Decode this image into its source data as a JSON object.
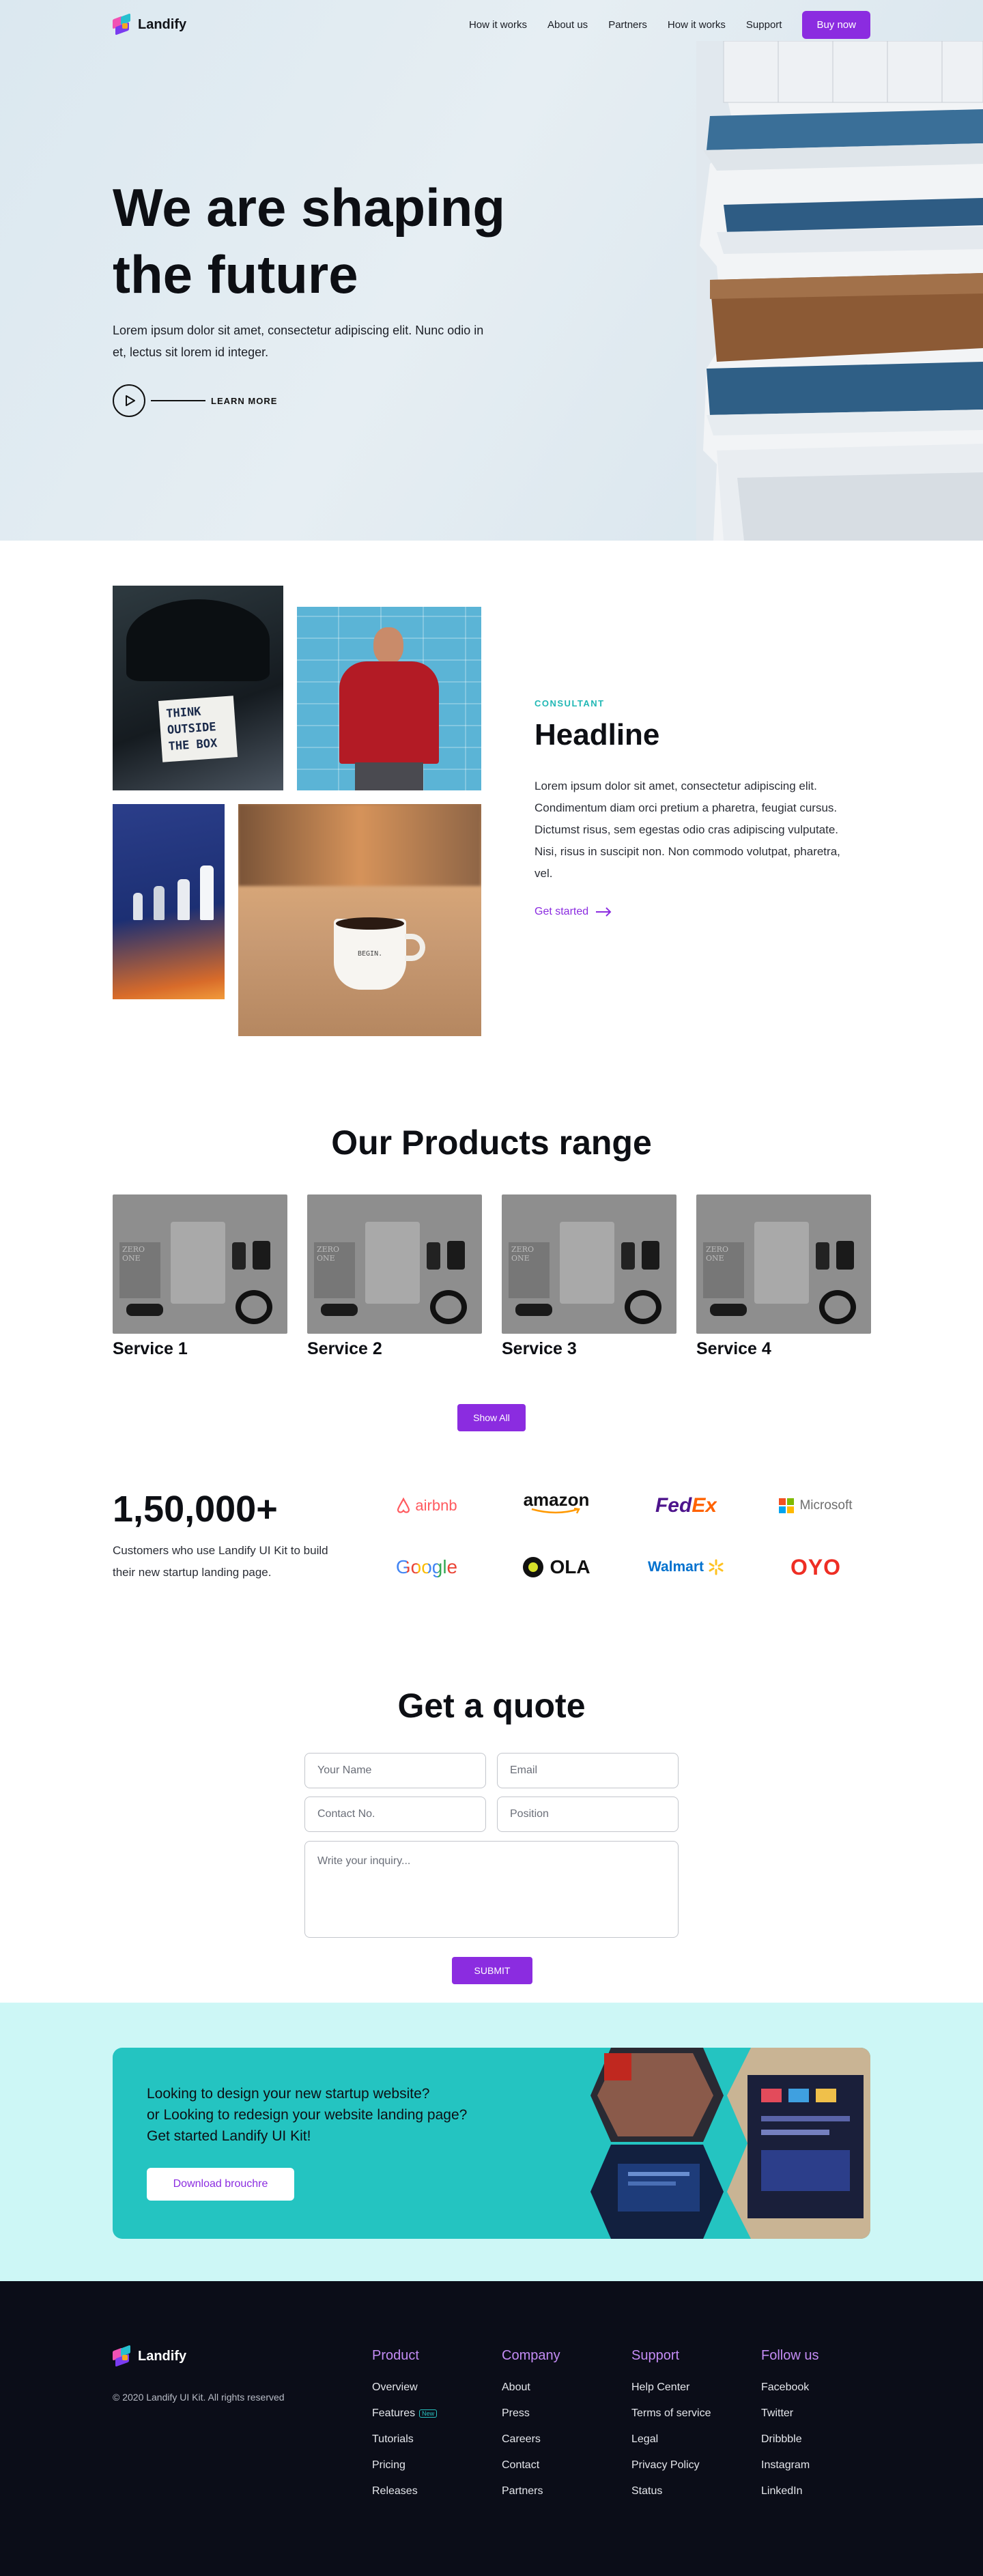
{
  "nav": {
    "logo": "Landify",
    "links": [
      "How it works",
      "About us",
      "Partners",
      "How it works",
      "Support"
    ],
    "cta": "Buy now"
  },
  "hero": {
    "title_line1": "We are shaping",
    "title_line2": "the future",
    "description": "Lorem ipsum dolor sit amet, consectetur adipiscing elit. Nunc odio in et, lectus sit lorem id integer.",
    "learn_more": "LEARN MORE"
  },
  "feature": {
    "eyebrow": "CONSULTANT",
    "headline": "Headline",
    "body": "Lorem ipsum dolor sit amet, consectetur adipiscing elit. Condimentum diam orci pretium a pharetra, feugiat cursus. Dictumst risus, sem egestas odio cras adipiscing vulputate. Nisi, risus in suscipit non. Non commodo volutpat, pharetra, vel.",
    "link": "Get started",
    "sign_text": [
      "THINK",
      "OUTSIDE",
      "THE BOX"
    ],
    "mug_text": "BEGIN."
  },
  "products": {
    "title": "Our Products range",
    "items": [
      "Service 1",
      "Service 2",
      "Service 3",
      "Service 4"
    ],
    "book_text": "ZERO ONE",
    "show_all": "Show All"
  },
  "stats": {
    "number": "1,50,000+",
    "description": "Customers who use Landify UI Kit to build their new startup landing page.",
    "brands": [
      "airbnb",
      "amazon",
      "FedEx",
      "Microsoft",
      "Google",
      "OLA",
      "Walmart",
      "OYO"
    ]
  },
  "quote": {
    "title": "Get a quote",
    "placeholders": {
      "name": "Your Name",
      "email": "Email",
      "contact": "Contact No.",
      "position": "Position",
      "inquiry": "Write your inquiry..."
    },
    "submit": "SUBMIT"
  },
  "cta": {
    "line1": "Looking to design your new startup website?",
    "line2": "or Looking to redesign your website landing page?",
    "line3": "Get started Landify UI Kit!",
    "button": "Download brouchre"
  },
  "footer": {
    "logo": "Landify",
    "copyright": "© 2020 Landify UI Kit. All rights reserved",
    "columns": [
      {
        "title": "Product",
        "links": [
          "Overview",
          "Features",
          "Tutorials",
          "Pricing",
          "Releases"
        ]
      },
      {
        "title": "Company",
        "links": [
          "About",
          "Press",
          "Careers",
          "Contact",
          "Partners"
        ]
      },
      {
        "title": "Support",
        "links": [
          "Help Center",
          "Terms of service",
          "Legal",
          "Privacy Policy",
          "Status"
        ]
      },
      {
        "title": "Follow us",
        "links": [
          "Facebook",
          "Twitter",
          "Dribbble",
          "Instagram",
          "LinkedIn"
        ]
      }
    ],
    "new_badge": "New"
  },
  "colors": {
    "accent": "#8b2ce0",
    "teal": "#24c4c1",
    "footer_bg": "#0b0d18",
    "hero_bg": "#dfeaf1"
  },
  "icons": [
    "landify-logo-icon",
    "play-icon",
    "arrow-right-icon"
  ]
}
